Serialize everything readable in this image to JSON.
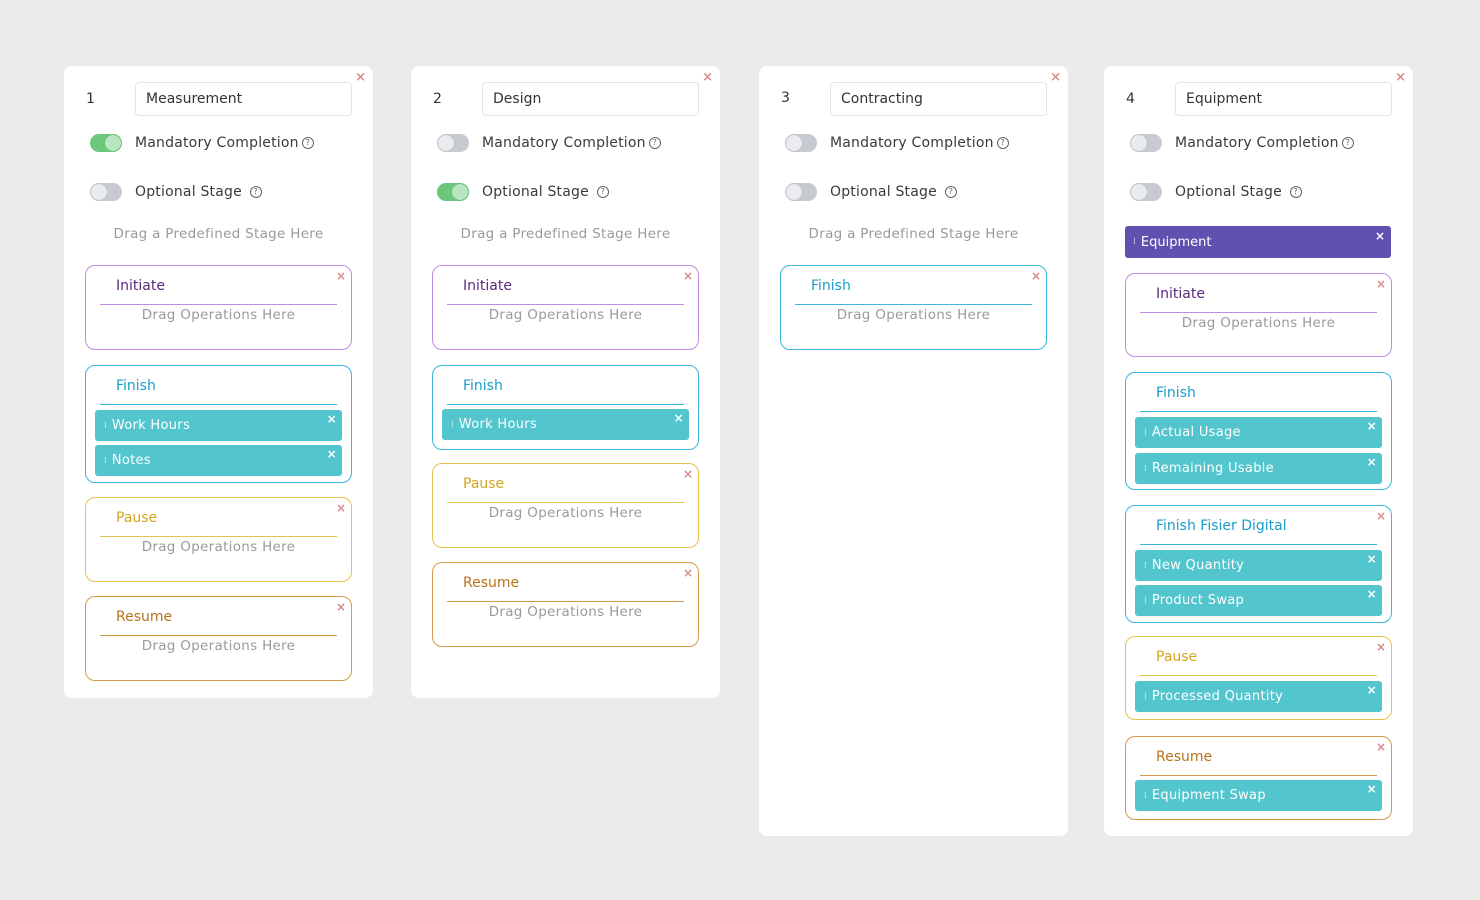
{
  "columns": [
    {
      "number": "1",
      "name": "Measurement",
      "mandatory_label": "Mandatory Completion",
      "mandatory_on": true,
      "optional_label": "Optional Stage",
      "optional_on": false,
      "predefined_placeholder": "Drag a Predefined Stage Here",
      "stages": [
        {
          "title": "Initiate",
          "type": "initiate",
          "drop_text": "Drag Operations Here",
          "operations": []
        },
        {
          "title": "Finish",
          "type": "finish",
          "drop_text": "",
          "operations": [
            "Work Hours",
            "Notes"
          ]
        },
        {
          "title": "Pause",
          "type": "pause",
          "drop_text": "Drag Operations Here",
          "operations": []
        },
        {
          "title": "Resume",
          "type": "resume",
          "drop_text": "Drag Operations Here",
          "operations": []
        }
      ]
    },
    {
      "number": "2",
      "name": "Design",
      "mandatory_label": "Mandatory Completion",
      "mandatory_on": false,
      "optional_label": "Optional Stage",
      "optional_on": true,
      "predefined_placeholder": "Drag a Predefined Stage Here",
      "stages": [
        {
          "title": "Initiate",
          "type": "initiate",
          "drop_text": "Drag Operations Here",
          "operations": []
        },
        {
          "title": "Finish",
          "type": "finish",
          "drop_text": "",
          "operations": [
            "Work Hours"
          ]
        },
        {
          "title": "Pause",
          "type": "pause",
          "drop_text": "Drag Operations Here",
          "operations": []
        },
        {
          "title": "Resume",
          "type": "resume",
          "drop_text": "Drag Operations Here",
          "operations": []
        }
      ]
    },
    {
      "number": "3",
      "name": "Contracting",
      "mandatory_label": "Mandatory Completion",
      "mandatory_on": false,
      "optional_label": "Optional Stage",
      "optional_on": false,
      "predefined_placeholder": "Drag a Predefined Stage Here",
      "stages": [
        {
          "title": "Finish",
          "type": "finish",
          "drop_text": "Drag Operations Here",
          "operations": []
        }
      ]
    },
    {
      "number": "4",
      "name": "Equipment",
      "mandatory_label": "Mandatory Completion",
      "mandatory_on": false,
      "optional_label": "Optional Stage",
      "optional_on": false,
      "predefined_stage": "Equipment",
      "stages": [
        {
          "title": "Initiate",
          "type": "initiate",
          "drop_text": "Drag Operations Here",
          "operations": []
        },
        {
          "title": "Finish",
          "type": "finish",
          "drop_text": "",
          "operations": [
            "Actual Usage",
            "Remaining Usable"
          ]
        },
        {
          "title": "Finish Fisier Digital",
          "type": "finish",
          "drop_text": "",
          "operations": [
            "New Quantity",
            "Product Swap"
          ]
        },
        {
          "title": "Pause",
          "type": "pause",
          "drop_text": "",
          "operations": [
            "Processed Quantity"
          ]
        },
        {
          "title": "Resume",
          "type": "resume",
          "drop_text": "",
          "operations": [
            "Equipment Swap"
          ]
        }
      ]
    }
  ],
  "icons": {
    "close": "×",
    "help": "?",
    "grip": "⁞"
  },
  "colors": {
    "page_bg": "#ebebeb",
    "toggle_on": "#6cc77d",
    "toggle_off": "#c7cbd1",
    "operation_chip": "#52c5cd",
    "predefined_chip": "#6150b0",
    "initiate": "#c08be0",
    "finish": "#3bb6de",
    "pause": "#e8c24a",
    "resume": "#d69a4a"
  }
}
